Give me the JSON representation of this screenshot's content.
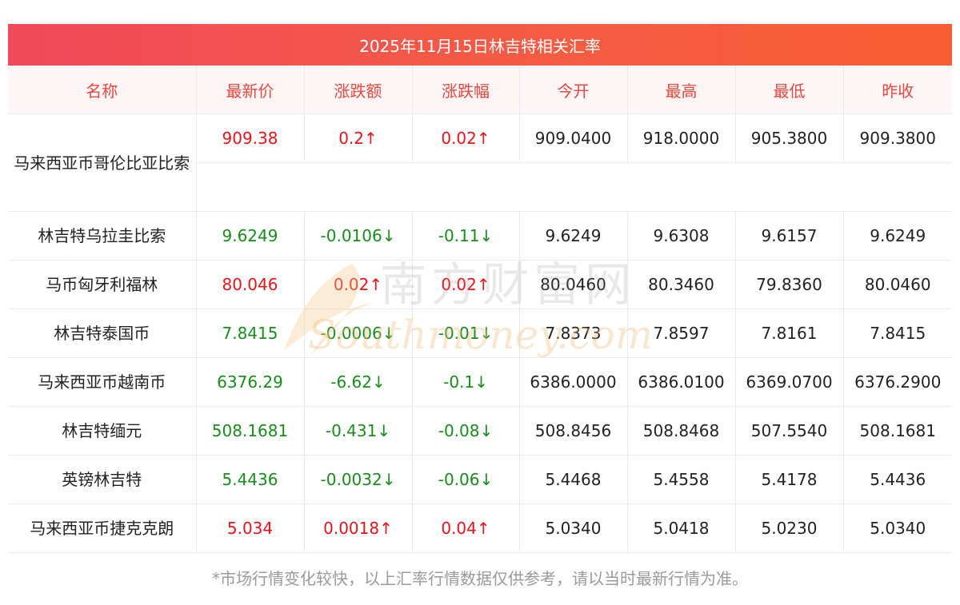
{
  "title": "2025年11月15日林吉特相关汇率",
  "headers": [
    "名称",
    "最新价",
    "涨跌额",
    "涨跌幅",
    "今开",
    "最高",
    "最低",
    "昨收"
  ],
  "rows": [
    {
      "name": "马来西亚币哥伦比亚比索",
      "latest": "909.38",
      "change": "0.2↑",
      "pct": "0.02↑",
      "open": "909.0400",
      "high": "918.0000",
      "low": "905.3800",
      "prev": "909.3800",
      "dir": "up"
    },
    {
      "name": "林吉特乌拉圭比索",
      "latest": "9.6249",
      "change": "-0.0106↓",
      "pct": "-0.11↓",
      "open": "9.6249",
      "high": "9.6308",
      "low": "9.6157",
      "prev": "9.6249",
      "dir": "down"
    },
    {
      "name": "马币匈牙利福林",
      "latest": "80.046",
      "change": "0.02↑",
      "pct": "0.02↑",
      "open": "80.0460",
      "high": "80.3460",
      "low": "79.8360",
      "prev": "80.0460",
      "dir": "up"
    },
    {
      "name": "林吉特泰国币",
      "latest": "7.8415",
      "change": "-0.0006↓",
      "pct": "-0.01↓",
      "open": "7.8373",
      "high": "7.8597",
      "low": "7.8161",
      "prev": "7.8415",
      "dir": "down"
    },
    {
      "name": "马来西亚币越南币",
      "latest": "6376.29",
      "change": "-6.62↓",
      "pct": "-0.1↓",
      "open": "6386.0000",
      "high": "6386.0100",
      "low": "6369.0700",
      "prev": "6376.2900",
      "dir": "down"
    },
    {
      "name": "林吉特缅元",
      "latest": "508.1681",
      "change": "-0.431↓",
      "pct": "-0.08↓",
      "open": "508.8456",
      "high": "508.8468",
      "low": "507.5540",
      "prev": "508.1681",
      "dir": "down"
    },
    {
      "name": "英镑林吉特",
      "latest": "5.4436",
      "change": "-0.0032↓",
      "pct": "-0.06↓",
      "open": "5.4468",
      "high": "5.4558",
      "low": "5.4178",
      "prev": "5.4436",
      "dir": "down"
    },
    {
      "name": "马来西亚币捷克克朗",
      "latest": "5.034",
      "change": "0.0018↑",
      "pct": "0.04↑",
      "open": "5.0340",
      "high": "5.0418",
      "low": "5.0230",
      "prev": "5.0340",
      "dir": "up"
    }
  ],
  "watermark": {
    "cn": "南方财富网",
    "en": "Southmoney.com"
  },
  "footnote": "*市场行情变化较快，以上汇率行情数据仅供参考，请以当时最新行情为准。",
  "colors": {
    "up": "#e8141a",
    "down": "#198c1e",
    "header_text": "#e8473e",
    "title_bg_start": "#f1485a",
    "title_bg_end": "#f85e33"
  }
}
